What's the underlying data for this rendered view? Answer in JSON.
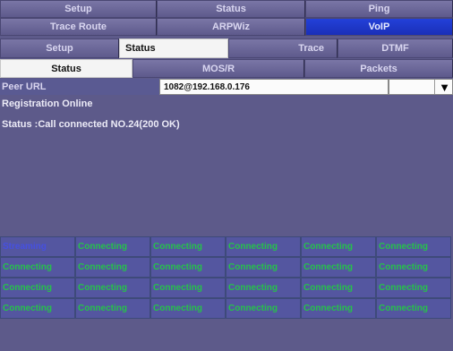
{
  "main_tabs_row1": [
    "Setup",
    "Status",
    "Ping"
  ],
  "main_tabs_row2": [
    "Trace Route",
    "ARPWiz",
    "VoIP"
  ],
  "voip_tabs": [
    "Setup",
    "Status",
    "Trace",
    "DTMF"
  ],
  "status_tabs": [
    "Status",
    "MOS/R",
    "Packets"
  ],
  "peer_url": {
    "label": "Peer URL",
    "value": "1082@192.168.0.176"
  },
  "registration": "Registration Online",
  "status_text": "Status :Call connected NO.24(200 OK)",
  "call_grid": [
    [
      "Streaming",
      "Connecting",
      "Connecting",
      "Connecting",
      "Connecting",
      "Connecting"
    ],
    [
      "Connecting",
      "Connecting",
      "Connecting",
      "Connecting",
      "Connecting",
      "Connecting"
    ],
    [
      "Connecting",
      "Connecting",
      "Connecting",
      "Connecting",
      "Connecting",
      "Connecting"
    ],
    [
      "Connecting",
      "Connecting",
      "Connecting",
      "Connecting",
      "Connecting",
      "Connecting"
    ]
  ],
  "icons": {
    "dropdown": "triangle-down-icon"
  },
  "colors": {
    "background": "#5d5a8a",
    "active_blue": "#2340d8",
    "connecting_text": "#26c24a",
    "selected_text": "#4650e0"
  }
}
